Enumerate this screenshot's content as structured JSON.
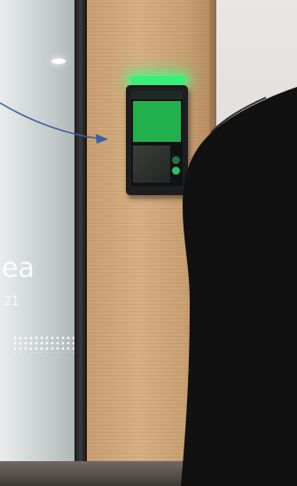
{
  "glass_text": {
    "word": "ea",
    "year": "21"
  },
  "device": {
    "status_label": "",
    "led_color": "#36f07a",
    "screen_color": "#22b04d",
    "state": "access-granted"
  },
  "annotation": {
    "arrow_color": "#3a5fa6"
  },
  "icons": [
    "arrow-annotation",
    "device-screen",
    "led-indicator"
  ]
}
